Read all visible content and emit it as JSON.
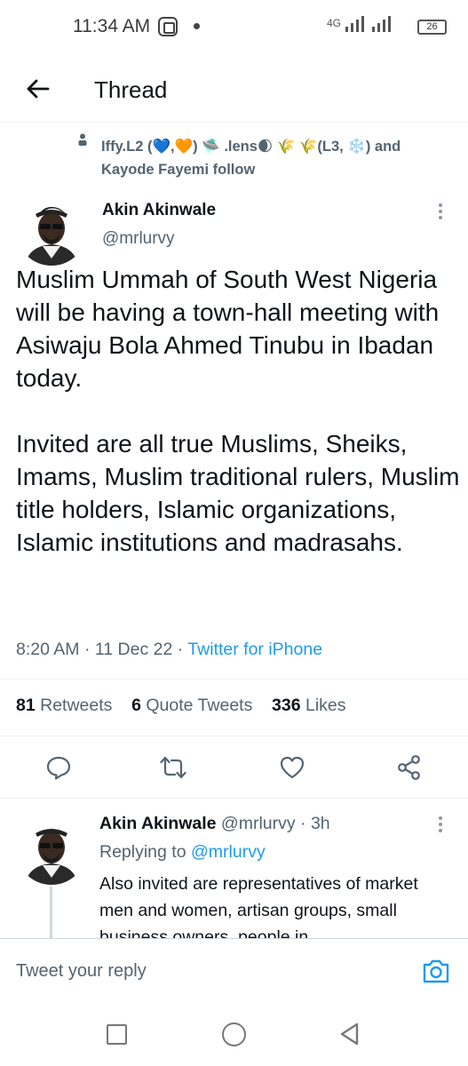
{
  "status_bar": {
    "time": "11:34 AM",
    "signal": "4G",
    "battery": "26"
  },
  "header": {
    "title": "Thread"
  },
  "social_context": {
    "text": "Iffy.L2 (💙,🧡) 🛸 .lens🌒 🌾 🌾(L3, ❄️) and Kayode Fayemi follow"
  },
  "tweet": {
    "author_name": "Akin Akinwale",
    "author_handle": "@mrlurvy",
    "text": "Muslim Ummah of South West Nigeria will be having a town-hall meeting with Asiwaju Bola Ahmed Tinubu in Ibadan today.\n\nInvited are all true Muslims, Sheiks, Imams, Muslim traditional rulers, Muslim title holders, Islamic organizations, Islamic institutions and madrasahs.",
    "time": "8:20 AM",
    "date": "11 Dec 22",
    "source": "Twitter for iPhone",
    "separator": " · "
  },
  "stats": {
    "retweets_count": "81",
    "retweets_label": "Retweets",
    "quote_count": "6",
    "quote_label": "Quote Tweets",
    "likes_count": "336",
    "likes_label": "Likes"
  },
  "reply": {
    "author_name": "Akin Akinwale",
    "author_handle": "@mrlurvy · 3h",
    "replying_to_label": "Replying to",
    "replying_to_handle": "@mrlurvy",
    "text": "Also invited are representatives of market men and women, artisan groups, small business owners, people in"
  },
  "compose": {
    "placeholder": "Tweet your reply"
  },
  "colors": {
    "accent": "#1d9bf0",
    "secondary_text": "#536471",
    "primary_text": "#0f1419"
  },
  "icons": {
    "back": "arrow-left-icon",
    "reply": "comment-icon",
    "retweet": "retweet-icon",
    "like": "heart-icon",
    "share": "share-icon",
    "camera": "camera-icon"
  }
}
